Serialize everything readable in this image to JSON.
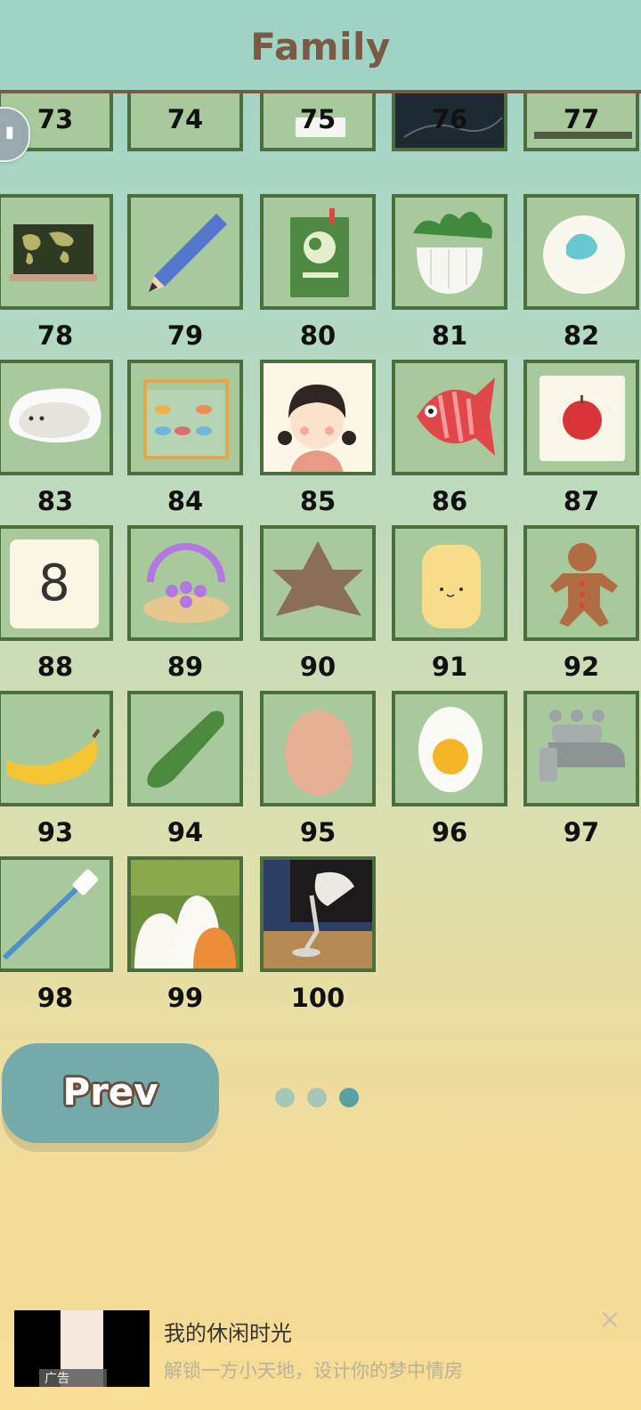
{
  "header": {
    "title": "Family"
  },
  "grid": {
    "top_row_numbers": [
      "73",
      "74",
      "75",
      "76",
      "77"
    ],
    "rows": [
      [
        {
          "num": "78",
          "icon": "world-map-icon"
        },
        {
          "num": "79",
          "icon": "pencil-icon"
        },
        {
          "num": "80",
          "icon": "green-book-icon"
        },
        {
          "num": "81",
          "icon": "plant-pot-icon"
        },
        {
          "num": "82",
          "icon": "soap-dish-icon"
        }
      ],
      [
        {
          "num": "83",
          "icon": "cat-pillow-icon"
        },
        {
          "num": "84",
          "icon": "fish-tank-icon"
        },
        {
          "num": "85",
          "icon": "girl-portrait-icon"
        },
        {
          "num": "86",
          "icon": "red-fish-icon"
        },
        {
          "num": "87",
          "icon": "apple-card-icon"
        }
      ],
      [
        {
          "num": "88",
          "icon": "number-tile-icon",
          "tile_text": "8"
        },
        {
          "num": "89",
          "icon": "purple-bracelet-icon"
        },
        {
          "num": "90",
          "icon": "star-cookie-icon"
        },
        {
          "num": "91",
          "icon": "cat-candle-icon"
        },
        {
          "num": "92",
          "icon": "gingerbread-icon"
        }
      ],
      [
        {
          "num": "93",
          "icon": "banana-icon"
        },
        {
          "num": "94",
          "icon": "cucumber-icon"
        },
        {
          "num": "95",
          "icon": "egg-icon"
        },
        {
          "num": "96",
          "icon": "fried-egg-icon"
        },
        {
          "num": "97",
          "icon": "faucet-icon"
        }
      ],
      [
        {
          "num": "98",
          "icon": "toothbrush-icon"
        },
        {
          "num": "99",
          "icon": "cats-picture-icon"
        },
        {
          "num": "100",
          "icon": "desk-lamp-icon"
        }
      ]
    ]
  },
  "nav": {
    "prev_label": "Prev",
    "pages": 3,
    "current_page": 3
  },
  "ad": {
    "tag": "广告",
    "title": "我的休闲时光",
    "subtitle": "解锁一方小天地，设计你的梦中情房",
    "close": "×"
  },
  "colors": {
    "header_bg": "#9ed3c6",
    "title": "#7a5a45",
    "tile_border": "#4b6e3f",
    "tile_bg": "#a8c99c",
    "button": "#75aaaa",
    "dot_active": "#5aa2a2"
  }
}
